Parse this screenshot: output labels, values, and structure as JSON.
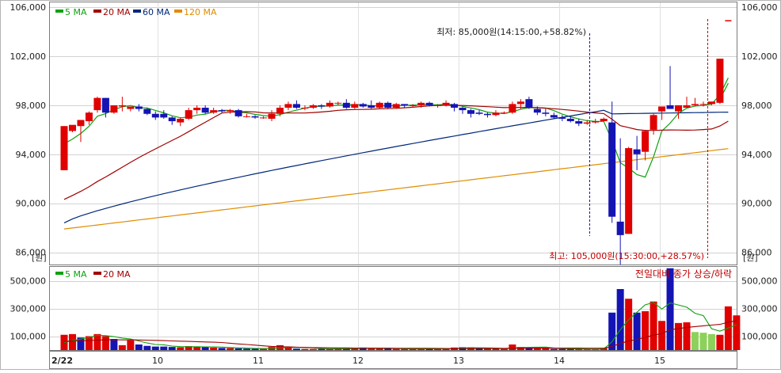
{
  "colors": {
    "up": "#e00000",
    "down": "#1414b4",
    "ma5": "#10a010",
    "ma20": "#a00000",
    "ma60": "#00287a",
    "ma120": "#e08c00",
    "vol_neutral": "#8cd25a",
    "annotation": "#c00000"
  },
  "chart_data": [
    {
      "type": "candlestick",
      "legend": [
        "5 MA",
        "20 MA",
        "60 MA",
        "120 MA"
      ],
      "unit_label": "[원]",
      "y_ticks": [
        86000,
        90000,
        94000,
        98000,
        102000,
        106000
      ],
      "y_tick_labels": [
        "86,000",
        "90,000",
        "94,000",
        "98,000",
        "102,000",
        "106,000"
      ],
      "ylim": [
        85000,
        106400
      ],
      "annotation_low": "최저: 85,000원(14:15:00,+58.82%)",
      "annotation_high": "최고: 105,000원(15:30:00,+28.57%)",
      "candles": [
        [
          0,
          92700,
          96300,
          92700,
          96300
        ],
        [
          1,
          95900,
          96400,
          95800,
          96000
        ],
        [
          2,
          96300,
          96800,
          95000,
          96800
        ],
        [
          3,
          96700,
          97400,
          96400,
          97500
        ],
        [
          4,
          97600,
          98600,
          97400,
          98700
        ],
        [
          5,
          98600,
          97400,
          97000,
          98600
        ],
        [
          6,
          97400,
          98000,
          97300,
          98000
        ],
        [
          7,
          97900,
          98000,
          97500,
          98700
        ],
        [
          8,
          97700,
          97900,
          97500,
          97800
        ],
        [
          9,
          97900,
          97700,
          97500,
          98100
        ],
        [
          10,
          97700,
          97300,
          97200,
          97800
        ],
        [
          11,
          97300,
          97000,
          96800,
          97500
        ],
        [
          12,
          97300,
          97000,
          96900,
          97600
        ],
        [
          13,
          97000,
          96700,
          96400,
          97100
        ],
        [
          14,
          96600,
          96900,
          96300,
          97000
        ],
        [
          15,
          96900,
          97600,
          96800,
          97800
        ],
        [
          16,
          97600,
          97800,
          97300,
          98000
        ],
        [
          17,
          97800,
          97400,
          97300,
          98000
        ],
        [
          18,
          97400,
          97600,
          97300,
          97800
        ],
        [
          19,
          97600,
          97500,
          97400,
          97700
        ],
        [
          20,
          97500,
          97600,
          97300,
          97700
        ],
        [
          21,
          97600,
          97100,
          97000,
          97700
        ],
        [
          22,
          97100,
          97100,
          97000,
          97300
        ],
        [
          23,
          97100,
          97000,
          96900,
          97200
        ],
        [
          24,
          97000,
          97000,
          96900,
          97100
        ],
        [
          25,
          96900,
          97300,
          96700,
          97600
        ],
        [
          26,
          97300,
          97800,
          97100,
          98000
        ],
        [
          27,
          97800,
          98100,
          97600,
          98300
        ],
        [
          28,
          98100,
          97800,
          97700,
          98400
        ],
        [
          29,
          97800,
          97800,
          97600,
          98000
        ],
        [
          30,
          97800,
          98000,
          97700,
          98100
        ],
        [
          31,
          98000,
          97900,
          97700,
          98100
        ],
        [
          32,
          97900,
          98200,
          97800,
          98400
        ],
        [
          33,
          98200,
          98200,
          98000,
          98300
        ],
        [
          34,
          98200,
          97800,
          97700,
          98500
        ],
        [
          35,
          97800,
          98100,
          97700,
          98300
        ],
        [
          36,
          98100,
          97900,
          97800,
          98200
        ],
        [
          37,
          98000,
          97800,
          97700,
          98400
        ],
        [
          38,
          97800,
          98200,
          97700,
          98300
        ],
        [
          39,
          98200,
          97800,
          97700,
          98300
        ],
        [
          40,
          97800,
          98100,
          97700,
          98200
        ],
        [
          41,
          98100,
          98000,
          97800,
          98100
        ],
        [
          42,
          98000,
          98000,
          97800,
          98100
        ],
        [
          43,
          98000,
          98200,
          97800,
          98300
        ],
        [
          44,
          98200,
          98000,
          97900,
          98300
        ],
        [
          45,
          98000,
          98000,
          97800,
          98100
        ],
        [
          46,
          98000,
          98200,
          97900,
          98400
        ],
        [
          47,
          98100,
          97800,
          97500,
          98200
        ],
        [
          48,
          97800,
          97600,
          97300,
          97900
        ],
        [
          49,
          97600,
          97300,
          97000,
          97700
        ],
        [
          50,
          97400,
          97300,
          97200,
          97600
        ],
        [
          51,
          97300,
          97200,
          97000,
          97400
        ],
        [
          52,
          97200,
          97400,
          97100,
          97600
        ],
        [
          53,
          97400,
          97400,
          97300,
          97500
        ],
        [
          54,
          97400,
          98100,
          97300,
          98300
        ],
        [
          55,
          98100,
          98300,
          97700,
          98500
        ],
        [
          56,
          98500,
          97800,
          97700,
          98700
        ],
        [
          57,
          97700,
          97400,
          97200,
          97900
        ],
        [
          58,
          97400,
          97300,
          97100,
          97700
        ],
        [
          59,
          97200,
          97000,
          96900,
          97400
        ],
        [
          60,
          97000,
          96900,
          96700,
          97200
        ],
        [
          61,
          96900,
          96700,
          96600,
          97100
        ],
        [
          62,
          96700,
          96500,
          96300,
          96900
        ],
        [
          63,
          96500,
          96600,
          96400,
          96800
        ],
        [
          64,
          96600,
          96700,
          96500,
          96900
        ],
        [
          65,
          96700,
          96900,
          96700,
          97000
        ],
        [
          66,
          96600,
          88900,
          88400,
          98300
        ],
        [
          67,
          88500,
          87400,
          85000,
          95300
        ],
        [
          68,
          87500,
          94500,
          87500,
          94600
        ],
        [
          69,
          94400,
          94000,
          92700,
          95500
        ],
        [
          70,
          94200,
          95900,
          93500,
          96000
        ],
        [
          71,
          96000,
          97200,
          95600,
          97300
        ],
        [
          72,
          97500,
          97900,
          96800,
          97800
        ],
        [
          73,
          98000,
          97700,
          97700,
          101200
        ],
        [
          74,
          97500,
          98000,
          96900,
          98000
        ],
        [
          75,
          97800,
          98000,
          97800,
          98700
        ],
        [
          76,
          98000,
          98100,
          97900,
          98600
        ],
        [
          77,
          98100,
          98100,
          97900,
          98300
        ],
        [
          78,
          98100,
          98300,
          98000,
          98300
        ],
        [
          79,
          98200,
          101800,
          98100,
          101800
        ],
        [
          80,
          104900,
          104900,
          104900,
          104900
        ]
      ]
    },
    {
      "type": "volume-bar",
      "legend": [
        "5 MA",
        "20 MA"
      ],
      "note": "전일대비 종가 상승/하락",
      "y_ticks": [
        100000,
        300000,
        500000
      ],
      "y_tick_labels": [
        "100,000",
        "300,000",
        "500,000"
      ],
      "ylim": [
        0,
        600000
      ],
      "x_tick_labels": [
        "2/22",
        "10",
        "11",
        "12",
        "13",
        "14",
        "15"
      ],
      "volumes": [
        [
          0,
          110000,
          "up"
        ],
        [
          1,
          115000,
          "up"
        ],
        [
          2,
          90000,
          "down"
        ],
        [
          3,
          100000,
          "up"
        ],
        [
          4,
          115000,
          "up"
        ],
        [
          5,
          100000,
          "up"
        ],
        [
          6,
          80000,
          "down"
        ],
        [
          7,
          35000,
          "up"
        ],
        [
          8,
          70000,
          "up"
        ],
        [
          9,
          40000,
          "down"
        ],
        [
          10,
          30000,
          "down"
        ],
        [
          11,
          25000,
          "down"
        ],
        [
          12,
          25000,
          "down"
        ],
        [
          13,
          22000,
          "down"
        ],
        [
          14,
          20000,
          "up"
        ],
        [
          15,
          28000,
          "up"
        ],
        [
          16,
          25000,
          "up"
        ],
        [
          17,
          20000,
          "down"
        ],
        [
          18,
          18000,
          "up"
        ],
        [
          19,
          15000,
          "down"
        ],
        [
          20,
          14000,
          "up"
        ],
        [
          21,
          12000,
          "down"
        ],
        [
          22,
          10000,
          "down"
        ],
        [
          23,
          9000,
          "down"
        ],
        [
          24,
          8000,
          "up"
        ],
        [
          25,
          22000,
          "up"
        ],
        [
          26,
          35000,
          "up"
        ],
        [
          27,
          20000,
          "up"
        ],
        [
          28,
          10000,
          "down"
        ],
        [
          29,
          8000,
          "up"
        ],
        [
          30,
          8000,
          "up"
        ],
        [
          31,
          8000,
          "down"
        ],
        [
          32,
          10000,
          "up"
        ],
        [
          33,
          12000,
          "up"
        ],
        [
          34,
          12000,
          "down"
        ],
        [
          35,
          14000,
          "up"
        ],
        [
          36,
          18000,
          "down"
        ],
        [
          37,
          10000,
          "up"
        ],
        [
          38,
          10000,
          "up"
        ],
        [
          39,
          10000,
          "down"
        ],
        [
          40,
          8000,
          "up"
        ],
        [
          41,
          8000,
          "up"
        ],
        [
          42,
          10000,
          "up"
        ],
        [
          43,
          10000,
          "up"
        ],
        [
          44,
          8000,
          "down"
        ],
        [
          45,
          10000,
          "up"
        ],
        [
          46,
          12000,
          "up"
        ],
        [
          47,
          18000,
          "up"
        ],
        [
          48,
          20000,
          "down"
        ],
        [
          49,
          20000,
          "up"
        ],
        [
          50,
          10000,
          "down"
        ],
        [
          51,
          10000,
          "up"
        ],
        [
          52,
          10000,
          "up"
        ],
        [
          53,
          8000,
          "up"
        ],
        [
          54,
          40000,
          "up"
        ],
        [
          55,
          22000,
          "up"
        ],
        [
          56,
          20000,
          "down"
        ],
        [
          57,
          12000,
          "up"
        ],
        [
          58,
          12000,
          "up"
        ],
        [
          59,
          8000,
          "down"
        ],
        [
          60,
          8000,
          "down"
        ],
        [
          61,
          8000,
          "down"
        ],
        [
          62,
          6000,
          "up"
        ],
        [
          63,
          5000,
          "up"
        ],
        [
          64,
          4000,
          "up"
        ],
        [
          65,
          14000,
          "up"
        ],
        [
          66,
          270000,
          "down"
        ],
        [
          67,
          440000,
          "down"
        ],
        [
          68,
          370000,
          "up"
        ],
        [
          69,
          270000,
          "down"
        ],
        [
          70,
          280000,
          "up"
        ],
        [
          71,
          350000,
          "up"
        ],
        [
          72,
          210000,
          "up"
        ],
        [
          73,
          590000,
          "down"
        ],
        [
          74,
          195000,
          "up"
        ],
        [
          75,
          200000,
          "up"
        ],
        [
          76,
          130000,
          "neutral"
        ],
        [
          77,
          125000,
          "neutral"
        ],
        [
          78,
          115000,
          "neutral"
        ],
        [
          79,
          110000,
          "up"
        ],
        [
          80,
          315000,
          "up"
        ],
        [
          81,
          250000,
          "up"
        ]
      ]
    }
  ]
}
